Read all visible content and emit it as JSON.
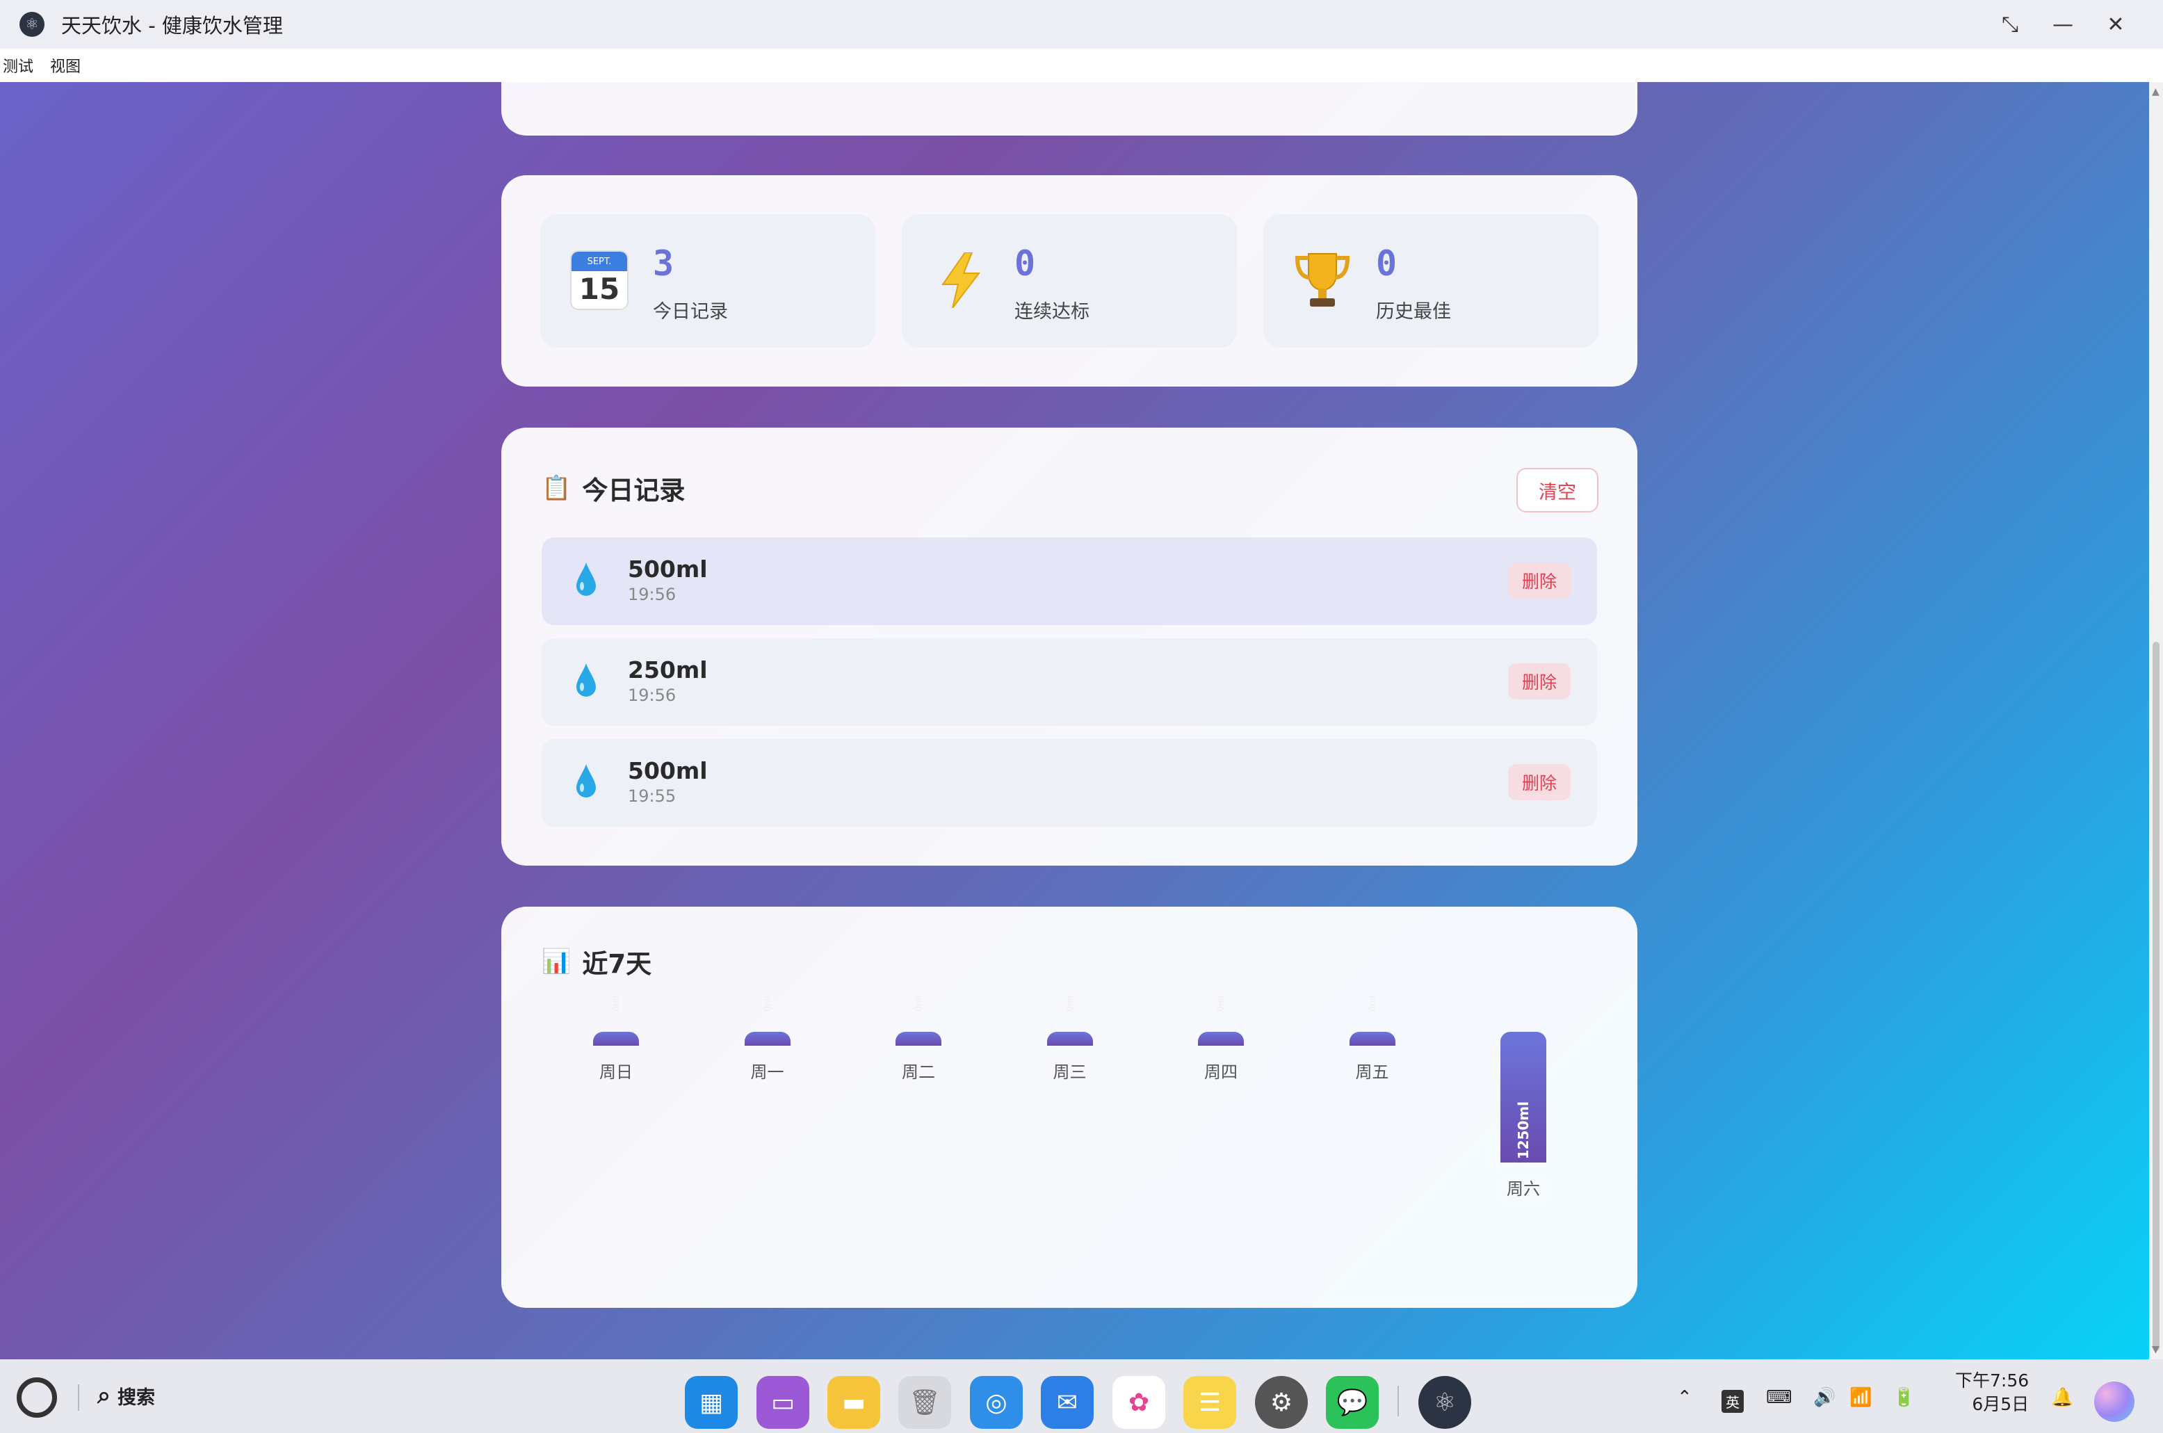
{
  "window": {
    "title": "天天饮水 - 健康饮水管理",
    "controls": [
      "restore",
      "minimize",
      "close"
    ]
  },
  "menubar": {
    "items": [
      "测试",
      "视图"
    ]
  },
  "stats": [
    {
      "icon": "calendar-icon",
      "calendar_month": "SEPT.",
      "calendar_day": "15",
      "value": "3",
      "label": "今日记录"
    },
    {
      "icon": "lightning-icon",
      "value": "0",
      "label": "连续达标"
    },
    {
      "icon": "trophy-icon",
      "value": "0",
      "label": "历史最佳"
    }
  ],
  "records": {
    "title": "今日记录",
    "clear_label": "清空",
    "items": [
      {
        "amount": "500ml",
        "time": "19:56",
        "delete_label": "删除"
      },
      {
        "amount": "250ml",
        "time": "19:56",
        "delete_label": "删除"
      },
      {
        "amount": "500ml",
        "time": "19:55",
        "delete_label": "删除"
      }
    ]
  },
  "chart": {
    "title": "近7天"
  },
  "chart_data": {
    "type": "bar",
    "categories": [
      "周日",
      "周一",
      "周二",
      "周三",
      "周四",
      "周五",
      "周六"
    ],
    "values": [
      0,
      0,
      0,
      0,
      0,
      0,
      1250
    ],
    "value_labels": [
      "0ml",
      "0ml",
      "0ml",
      "0ml",
      "0ml",
      "0ml",
      "1250ml"
    ],
    "unit": "ml",
    "bar_color": "#6a6bd2"
  },
  "taskbar": {
    "search_label": "搜索",
    "dock": [
      "app-grid-icon",
      "folder-purple-icon",
      "files-icon",
      "trash-icon",
      "browser-icon",
      "mail-icon",
      "photos-icon",
      "notes-icon",
      "settings-icon",
      "wechat-icon",
      "electron-app-icon"
    ],
    "tray": {
      "ime": "英",
      "time": "下午7:56",
      "date": "6月5日"
    }
  },
  "colors": {
    "accent": "#6b72d8",
    "danger": "#e04050"
  }
}
